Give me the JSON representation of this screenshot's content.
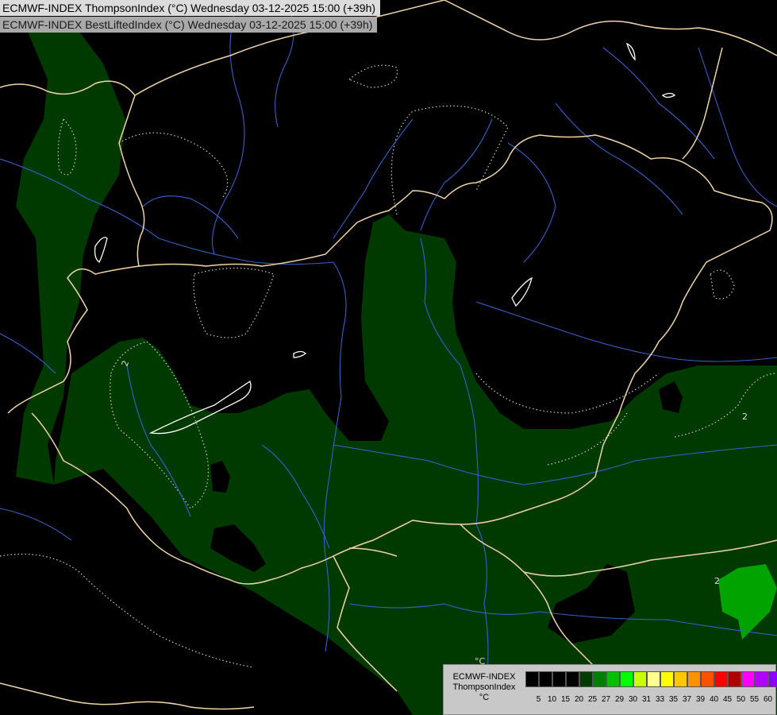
{
  "header": {
    "line1": "ECMWF-INDEX ThompsonIndex (°C) Wednesday 03-12-2025 15:00 (+39h)",
    "line2": "ECMWF-INDEX BestLiftedIndex (°C) Wednesday 03-12-2025 15:00 (+39h)"
  },
  "map": {
    "contour_labels": [
      "2",
      "2",
      "2"
    ],
    "marker": "°C",
    "colors": {
      "background": "#000000",
      "dark_green": "#003a00",
      "bright_green": "#00a300",
      "rivers": "#3a5fc8",
      "borders": "#f0d5a8",
      "lakes": "#ffffff",
      "contours": "#cccccc"
    }
  },
  "legend": {
    "title": "ECMWF-INDEX",
    "subtitle": "ThompsonIndex",
    "unit": "°C",
    "colors": [
      "#000000",
      "#000000",
      "#000000",
      "#000000",
      "#003c00",
      "#007f00",
      "#00c000",
      "#00ff00",
      "#c8ff00",
      "#ffff90",
      "#ffff00",
      "#ffc800",
      "#ff9000",
      "#ff5000",
      "#ff0000",
      "#b00000",
      "#ff00ff",
      "#b400ff",
      "#8c00ff",
      "#5000ff",
      "#0000ff"
    ],
    "ticks": [
      "5",
      "10",
      "15",
      "20",
      "25",
      "27",
      "29",
      "30",
      "31",
      "33",
      "35",
      "37",
      "39",
      "40",
      "45",
      "50",
      "55",
      "60"
    ]
  }
}
